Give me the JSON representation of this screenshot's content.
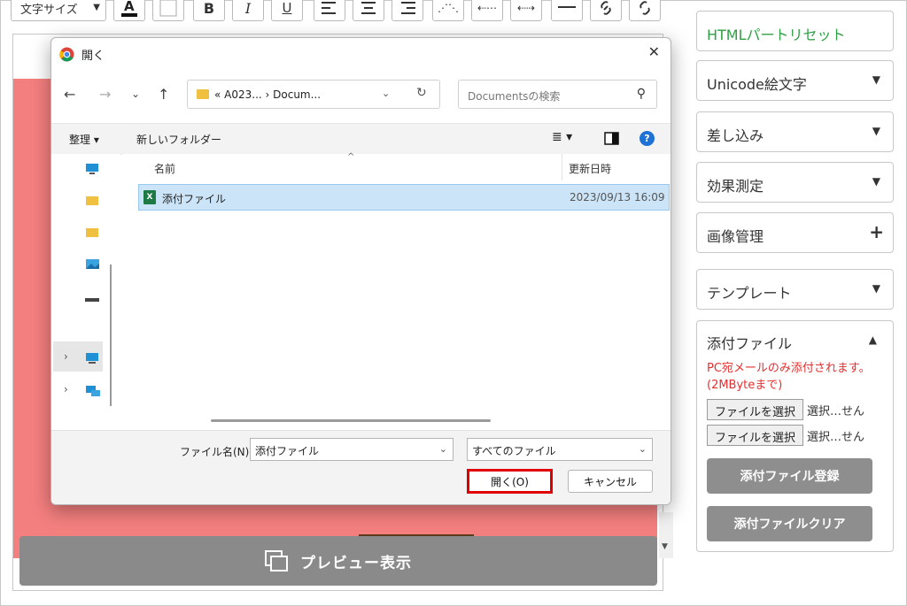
{
  "toolbar": {
    "font_size_label": "文字サイズ",
    "bold_label": "B",
    "italic_label": "I",
    "underline_label": "U"
  },
  "editor": {
    "preview_label": "プレビュー表示"
  },
  "sidebar": {
    "html_reset": "HTMLパートリセット",
    "unicode_emoji": "Unicode絵文字",
    "insert": "差し込み",
    "effect": "効果測定",
    "image": "画像管理",
    "template": "テンプレート",
    "attach": {
      "title": "添付ファイル",
      "note": "PC宛メールのみ添付されます。(2MByteまで)",
      "choose_label": "ファイルを選択",
      "status": "選択…せん",
      "register": "添付ファイル登録",
      "clear": "添付ファイルクリア"
    }
  },
  "dialog": {
    "title": "開く",
    "address": "« A023... › Docum...",
    "search_placeholder": "Documentsの検索",
    "organize": "整理 ▾",
    "new_folder": "新しいフォルダー",
    "col_name": "名前",
    "col_date": "更新日時",
    "files": [
      {
        "name": "添付ファイル",
        "date": "2023/09/13 16:09"
      }
    ],
    "filename_label": "ファイル名(N):",
    "filename_value": "添付ファイル",
    "filetype": "すべてのファイル",
    "open_label": "開く(O)",
    "cancel_label": "キャンセル"
  },
  "colors": {
    "canvas": "#f47f7f",
    "accent_green": "#2ea043",
    "warning_red": "#e53030",
    "highlight_red": "#e00000",
    "selection": "#cce4f7"
  }
}
